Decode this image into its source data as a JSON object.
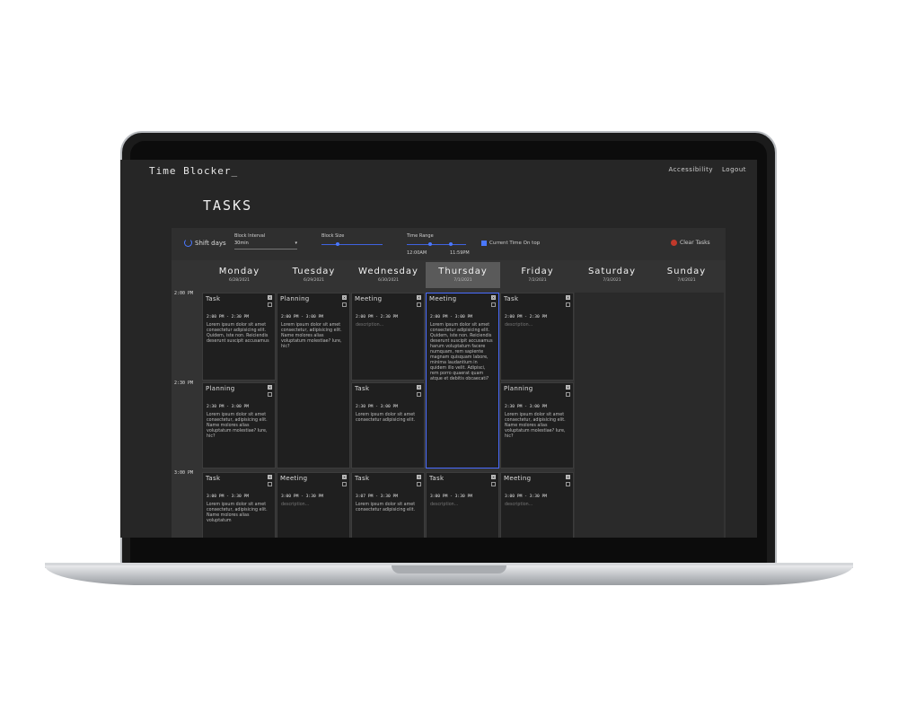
{
  "app": {
    "title": "Time Blocker_"
  },
  "nav": {
    "accessibility": "Accessibility",
    "logout": "Logout"
  },
  "page": {
    "title": "TASKS"
  },
  "toolbar": {
    "shift_days": "Shift days",
    "block_interval_label": "Block Interval",
    "block_interval_value": "30min",
    "block_size_label": "Block Size",
    "time_range_label": "Time Range",
    "time_range_start": "12:00AM",
    "time_range_end": "11:59PM",
    "current_time_label": "Current Time On top",
    "clear_tasks": "Clear Tasks"
  },
  "days": [
    {
      "name": "Monday",
      "date": "6/28/2021"
    },
    {
      "name": "Tuesday",
      "date": "6/29/2021"
    },
    {
      "name": "Wednesday",
      "date": "6/30/2021"
    },
    {
      "name": "Thursday",
      "date": "7/1/2021"
    },
    {
      "name": "Friday",
      "date": "7/2/2021"
    },
    {
      "name": "Saturday",
      "date": "7/3/2021"
    },
    {
      "name": "Sunday",
      "date": "7/4/2021"
    }
  ],
  "times": [
    "2:00 PM",
    "2:30 PM",
    "3:00 PM"
  ],
  "cards": [
    {
      "title": "Task",
      "time": "2:00 PM - 2:30 PM",
      "desc": "Lorem ipsum dolor sit amet consectetur adipisicing elit. Quidem, iste non. Reiciendis deserunt suscipit accusamus"
    },
    {
      "title": "Planning",
      "time": "2:00 PM - 3:00 PM",
      "desc": "Lorem ipsum dolor sit amet consectetur, adipisicing elit. Name molores alias voluptatum molestiae? Iure, hic?"
    },
    {
      "title": "Meeting",
      "time": "2:00 PM - 2:30 PM",
      "desc": "description..."
    },
    {
      "title": "Meeting",
      "time": "2:00 PM - 3:00 PM",
      "desc": "Lorem ipsum dolor sit amet consectetur adipisicing elit. Quidem, iste non. Reiciendis deserunt suscipit accusamus harum voluptatum facere numquam, rem sapiente magnam quisquam labore, minima laudantium in quidem illo velit. Adipisci, rem porro quaerat quam atque et debitis obcaecati?"
    },
    {
      "title": "Task",
      "time": "2:00 PM - 2:30 PM",
      "desc": "description..."
    },
    {
      "title": "Planning",
      "time": "2:30 PM - 3:00 PM",
      "desc": "Lorem ipsum dolor sit amet consectetur, adipisicing elit. Name molores alias voluptatum molestiae? Iure, hic?"
    },
    {
      "title": "Task",
      "time": "2:30 PM - 3:00 PM",
      "desc": "Lorem ipsum dolor sit amet consectetur adipisicing elit."
    },
    {
      "title": "Planning",
      "time": "2:30 PM - 3:00 PM",
      "desc": "Lorem ipsum dolor sit amet consectetur, adipisicing elit. Name molores alias voluptatum molestiae? Iure, hic?"
    },
    {
      "title": "Task",
      "time": "3:00 PM - 3:30 PM",
      "desc": "Lorem ipsum dolor sit amet consectetur, adipisicing elit. Name molores alias voluptatum"
    },
    {
      "title": "Meeting",
      "time": "3:00 PM - 3:30 PM",
      "desc": "description..."
    },
    {
      "title": "Task",
      "time": "3:07 PM - 3:30 PM",
      "desc": "Lorem ipsum dolor sit amet consectetur adipisicing elit."
    },
    {
      "title": "Task",
      "time": "3:00 PM - 3:30 PM",
      "desc": "description..."
    },
    {
      "title": "Meeting",
      "time": "3:00 PM - 3:30 PM",
      "desc": "description..."
    }
  ]
}
